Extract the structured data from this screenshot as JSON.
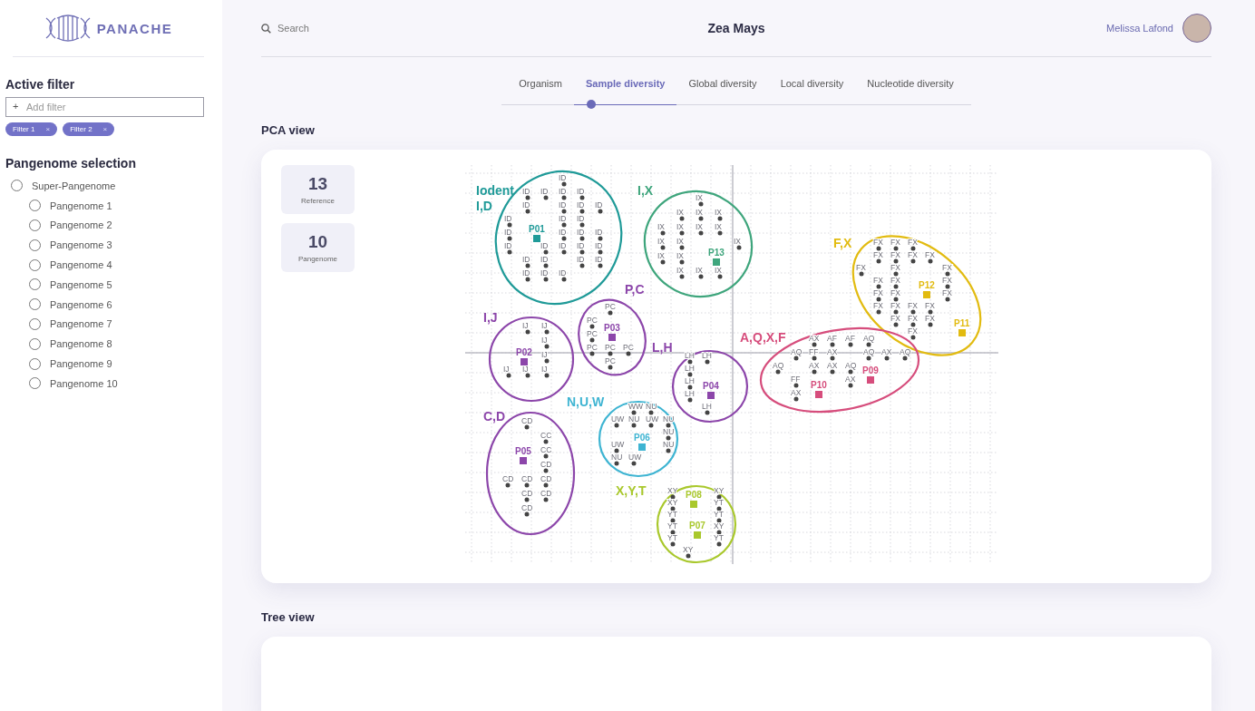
{
  "sidebar": {
    "logo": "PANACHE",
    "active_filter_title": "Active filter",
    "add_filter": {
      "icon": "+",
      "placeholder": "Add filter"
    },
    "filters": [
      {
        "label": "Filter 1",
        "remove": "×"
      },
      {
        "label": "Filter 2",
        "remove": "×"
      }
    ],
    "pangenome_title": "Pangenome selection",
    "tree": [
      {
        "label": "Super-Pangenome",
        "selected": false,
        "children": [
          {
            "label": "Pangenome 1",
            "selected": false
          },
          {
            "label": "Pangenome 2",
            "selected": false
          },
          {
            "label": "Pangenome 3",
            "selected": false
          },
          {
            "label": "Pangenome 4",
            "selected": false
          },
          {
            "label": "Pangenome 5",
            "selected": false
          },
          {
            "label": "Pangenome 6",
            "selected": false
          },
          {
            "label": "Pangenome 7",
            "selected": false
          },
          {
            "label": "Pangenome 8",
            "selected": false
          },
          {
            "label": "Pangenome 9",
            "selected": false
          },
          {
            "label": "Pangenome 10",
            "selected": false
          }
        ]
      }
    ]
  },
  "header": {
    "search": {
      "placeholder": "Search"
    },
    "title": "Zea Mays",
    "user": {
      "name": "Melissa Lafond"
    }
  },
  "tabs": [
    {
      "label": "Organism",
      "selected": false
    },
    {
      "label": "Sample diversity",
      "selected": true
    },
    {
      "label": "Global diversity",
      "selected": false
    },
    {
      "label": "Local diversity",
      "selected": false
    },
    {
      "label": "Nucleotide diversity",
      "selected": false
    }
  ],
  "pca_view": {
    "title": "PCA view",
    "stats": [
      {
        "value": "13",
        "label": "Reference"
      },
      {
        "value": "10",
        "label": "Pangenome"
      }
    ],
    "clusters": [
      {
        "label_lines": [
          "Iodent",
          "I,D"
        ],
        "color": "#1f9a98",
        "markers": [
          "P01"
        ],
        "point_labels": [
          "ID",
          "ID",
          "ID",
          "ID",
          "ID",
          "ID",
          "ID",
          "ID",
          "ID",
          "ID",
          "ID",
          "ID",
          "ID",
          "ID",
          "ID",
          "ID",
          "ID",
          "ID",
          "ID",
          "ID",
          "ID",
          "ID",
          "ID",
          "ID",
          "ID",
          "ID",
          "ID",
          "ID"
        ]
      },
      {
        "label_lines": [
          "I,X"
        ],
        "color": "#3ea57c",
        "markers": [
          "P13"
        ],
        "point_labels": [
          "IX",
          "IX",
          "IX",
          "IX",
          "IX",
          "IX",
          "IX",
          "IX",
          "IX",
          "IX",
          "IX",
          "IX",
          "IX",
          "IX",
          "IX",
          "IX"
        ]
      },
      {
        "label_lines": [
          "F,X"
        ],
        "color": "#e2bb10",
        "markers": [
          "P12",
          "P11"
        ],
        "point_labels": [
          "FX",
          "FX",
          "FX",
          "FX",
          "FX",
          "FX",
          "FX",
          "FX",
          "FX",
          "FX",
          "FX",
          "FX",
          "FX",
          "FX",
          "FX",
          "FX",
          "FX",
          "FX",
          "FX",
          "FX",
          "FX",
          "FX",
          "FX",
          "FX"
        ]
      },
      {
        "label_lines": [
          "A,Q,X,F"
        ],
        "color": "#d64d7c",
        "markers": [
          "P09",
          "P10"
        ],
        "point_labels": [
          "AX",
          "AF",
          "AF",
          "AQ",
          "AQ",
          "FF",
          "AX",
          "AQ",
          "AX",
          "AQ",
          "AQ",
          "AX",
          "AX",
          "AQ",
          "FF",
          "AX",
          "AX"
        ]
      },
      {
        "label_lines": [
          "P,C"
        ],
        "color": "#8c46aa",
        "markers": [
          "P03"
        ],
        "point_labels": [
          "PC",
          "PC",
          "PC",
          "PC",
          "PC",
          "PC",
          "PC"
        ]
      },
      {
        "label_lines": [
          "I,J"
        ],
        "color": "#8c46aa",
        "markers": [
          "P02"
        ],
        "point_labels": [
          "IJ",
          "IJ",
          "IJ",
          "IJ",
          "IJ",
          "IJ",
          "IJ"
        ]
      },
      {
        "label_lines": [
          "L,H"
        ],
        "color": "#8c46aa",
        "markers": [
          "P04"
        ],
        "point_labels": [
          "LH",
          "LH",
          "LH",
          "LH",
          "LH",
          "LH"
        ]
      },
      {
        "label_lines": [
          "C,D"
        ],
        "color": "#8c46aa",
        "markers": [
          "P05"
        ],
        "point_labels": [
          "CD",
          "CC",
          "CC",
          "CD",
          "CD",
          "CD",
          "CD",
          "CD",
          "CD",
          "CD"
        ]
      },
      {
        "label_lines": [
          "N,U,W"
        ],
        "color": "#3eb4d2",
        "markers": [
          "P06"
        ],
        "point_labels": [
          "WW",
          "NU",
          "UW",
          "NU",
          "UW",
          "NU",
          "NU",
          "UW",
          "NU",
          "NU",
          "UW"
        ]
      },
      {
        "label_lines": [
          "X,Y,T"
        ],
        "color": "#a9c82c",
        "markers": [
          "P08",
          "P07"
        ],
        "point_labels": [
          "XY",
          "XY",
          "XY",
          "YT",
          "YT",
          "YT",
          "YT",
          "XY",
          "YT",
          "YT",
          "XY"
        ]
      }
    ]
  },
  "tree_view": {
    "title": "Tree view"
  }
}
